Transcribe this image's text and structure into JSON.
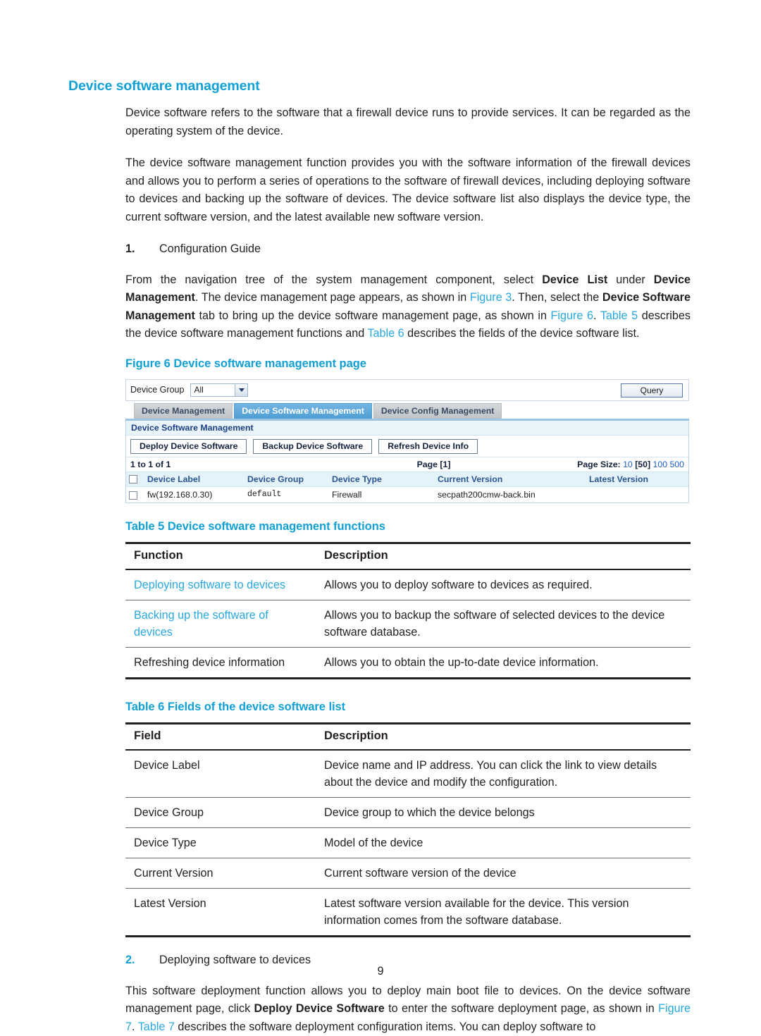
{
  "heading": "Device software management",
  "paragraphs": {
    "intro1": "Device software refers to the software that a firewall device runs to provide services. It can be regarded as the operating system of the device.",
    "intro2": "The device software management function provides you with the software information of the firewall devices and allows you to perform a series of operations to the software of firewall devices, including deploying software to devices and backing up the software of devices. The device software list also displays the device type, the current software version, and the latest available new software version."
  },
  "steps": {
    "one_num": "1.",
    "one_label": "Configuration Guide",
    "two_num": "2.",
    "two_label": "Deploying software to devices"
  },
  "guide_paragraph": {
    "p1": "From the navigation tree of the system management component, select ",
    "b1": "Device List",
    "p2": " under ",
    "b2": "Device Management",
    "p3": ". The device management page appears, as shown in ",
    "x1": "Figure 3",
    "p4": ". Then, select the ",
    "b3": "Device Software Management",
    "p5": " tab to bring up the device software management page, as shown in ",
    "x2": "Figure 6",
    "p6": ". ",
    "x3": "Table 5",
    "p7": " describes the device software management functions and ",
    "x4": "Table 6",
    "p8": " describes the fields of the device software list."
  },
  "deploy_paragraph": {
    "p1": "This software deployment function allows you to deploy main boot file to devices. On the device software management page, click ",
    "b1": "Deploy Device Software",
    "p2": " to enter the software deployment page, as shown in ",
    "x1": "Figure 7",
    "p3": ". ",
    "x2": "Table 7",
    "p4": " describes the software deployment configuration items. You can deploy software to"
  },
  "figure6": {
    "title": "Figure 6 Device software management page",
    "filter": {
      "label": "Device Group",
      "select_value": "All",
      "query_button": "Query"
    },
    "tabs": [
      {
        "label": "Device Management",
        "active": false
      },
      {
        "label": "Device Software Management",
        "active": true
      },
      {
        "label": "Device Config Management",
        "active": false
      }
    ],
    "panel_title": "Device Software Management",
    "buttons": [
      "Deploy Device Software",
      "Backup Device Software",
      "Refresh Device Info"
    ],
    "pager": {
      "count": "1 to 1 of 1",
      "page_label": "Page",
      "page_current": "[1]",
      "page_size_label": "Page Size:",
      "sizes": [
        "10",
        "50",
        "100",
        "500"
      ],
      "selected_size": "50"
    },
    "table": {
      "headers": [
        "Device Label",
        "Device Group",
        "Device Type",
        "Current Version",
        "Latest Version"
      ],
      "rows": [
        {
          "device_label": "fw(192.168.0.30)",
          "device_group": "default",
          "device_type": "Firewall",
          "current_version": "secpath200cmw-back.bin",
          "latest_version": ""
        }
      ]
    }
  },
  "table5": {
    "title": "Table 5 Device software management functions",
    "headers": [
      "Function",
      "Description"
    ],
    "rows": [
      {
        "function": "Deploying software to devices",
        "is_link": true,
        "description": "Allows you to deploy software to devices as required."
      },
      {
        "function": "Backing up the software of devices",
        "is_link": true,
        "description": "Allows you to backup the software of selected devices to the device software database."
      },
      {
        "function": "Refreshing device information",
        "is_link": false,
        "description": "Allows you to obtain the up-to-date device information."
      }
    ]
  },
  "table6": {
    "title": "Table 6 Fields of the device software list",
    "headers": [
      "Field",
      "Description"
    ],
    "rows": [
      {
        "field": "Device Label",
        "description": "Device name and IP address. You can click the link to view details about the device and modify the configuration."
      },
      {
        "field": "Device Group",
        "description": "Device group to which the device belongs"
      },
      {
        "field": "Device Type",
        "description": "Model of the device"
      },
      {
        "field": "Current Version",
        "description": "Current software version of the device"
      },
      {
        "field": "Latest Version",
        "description": "Latest software version available for the device. This version information comes from the software database."
      }
    ]
  },
  "page_number": "9",
  "colors": {
    "heading_blue": "#11a0d6",
    "xref_blue": "#29a8df",
    "tab_active": "#4d9ed4",
    "app_link": "#2436c8",
    "body_text": "#231f20"
  }
}
